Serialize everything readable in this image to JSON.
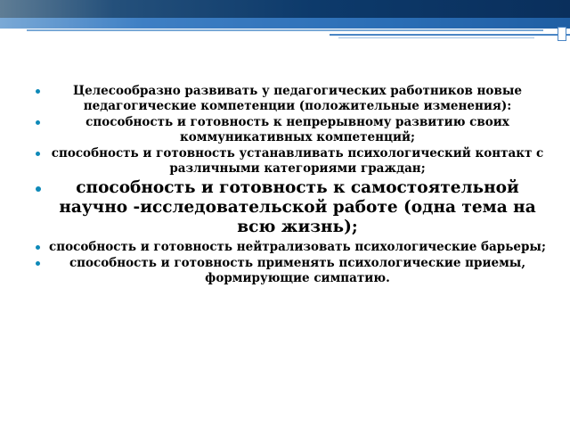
{
  "slide": {
    "bullets": [
      "Целесообразно развивать у педагогических работников новые педагогические компетенции (положительные изменения):",
      "способность и готовность к непрерывному развитию своих коммуникативных компетенций;",
      "способность и готовность устанавливать психологический контакт с различными категориями граждан;",
      "способность и готовность к самостоятельной научно -исследовательской работе (одна тема на всю жизнь);",
      "способность и готовность нейтрализовать психологические барьеры;",
      "способность и готовность применять психологические приемы, формирующие симпатию."
    ]
  },
  "colors": {
    "header_dark": "#0d3a6b",
    "header_light": "#3e7fc4",
    "bullet": "#0e89b8",
    "text": "#000000"
  }
}
